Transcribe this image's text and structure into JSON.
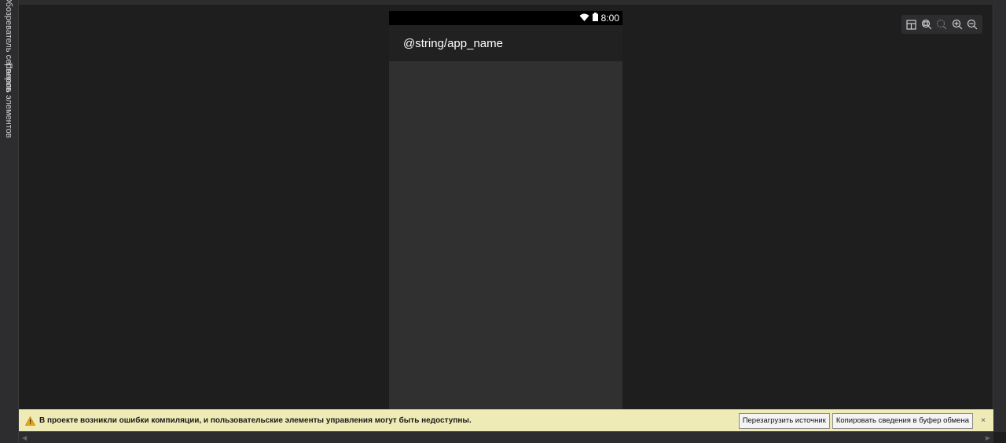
{
  "side_tabs": {
    "server_explorer": "Обозреватель серверов",
    "toolbox": "Панель элементов"
  },
  "device": {
    "status_time": "8:00",
    "app_title": "@string/app_name"
  },
  "zoom_toolbar": {
    "icons": [
      "layout-icon",
      "zoom-fit-icon",
      "zoom-actual-icon",
      "zoom-in-icon",
      "zoom-out-icon"
    ]
  },
  "infobar": {
    "message": "В проекте возникли ошибки компиляции, и пользовательские элементы управления могут быть недоступны.",
    "reload_label": "Перезагрузить источник",
    "copy_label": "Копировать сведения в буфер обмена",
    "close_glyph": "×"
  },
  "colors": {
    "background": "#1e1e1e",
    "phone_body": "#303030",
    "action_bar": "#212121",
    "infobar": "#efebb6",
    "warning": "#e8a317"
  }
}
